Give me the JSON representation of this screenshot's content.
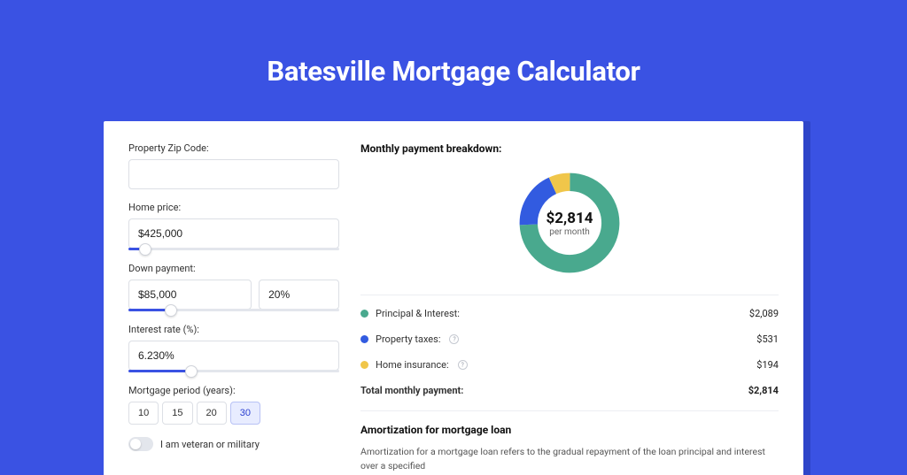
{
  "title": "Batesville Mortgage Calculator",
  "form": {
    "zip": {
      "label": "Property Zip Code:",
      "value": ""
    },
    "home_price": {
      "label": "Home price:",
      "value": "$425,000",
      "slider_pct": 8
    },
    "down_payment": {
      "label": "Down payment:",
      "value": "$85,000",
      "pct_value": "20%",
      "slider_pct": 20
    },
    "interest": {
      "label": "Interest rate (%):",
      "value": "6.230%",
      "slider_pct": 30
    },
    "period": {
      "label": "Mortgage period (years):",
      "options": [
        "10",
        "15",
        "20",
        "30"
      ],
      "selected": "30"
    },
    "veteran": {
      "label": "I am veteran or military",
      "on": false
    }
  },
  "breakdown": {
    "heading": "Monthly payment breakdown:",
    "center_amount": "$2,814",
    "center_sub": "per month",
    "items": [
      {
        "color": "green",
        "label": "Principal & Interest:",
        "value": "$2,089",
        "info": false
      },
      {
        "color": "blue",
        "label": "Property taxes:",
        "value": "$531",
        "info": true
      },
      {
        "color": "yellow",
        "label": "Home insurance:",
        "value": "$194",
        "info": true
      }
    ],
    "total_label": "Total monthly payment:",
    "total_value": "$2,814"
  },
  "amortization": {
    "heading": "Amortization for mortgage loan",
    "text": "Amortization for a mortgage loan refers to the gradual repayment of the loan principal and interest over a specified"
  },
  "chart_data": {
    "type": "pie",
    "title": "Monthly payment breakdown",
    "series": [
      {
        "name": "Principal & Interest",
        "value": 2089,
        "color": "#49a98e"
      },
      {
        "name": "Property taxes",
        "value": 531,
        "color": "#325be0"
      },
      {
        "name": "Home insurance",
        "value": 194,
        "color": "#f0c64a"
      }
    ],
    "total": 2814,
    "center_label": "$2,814 per month"
  }
}
